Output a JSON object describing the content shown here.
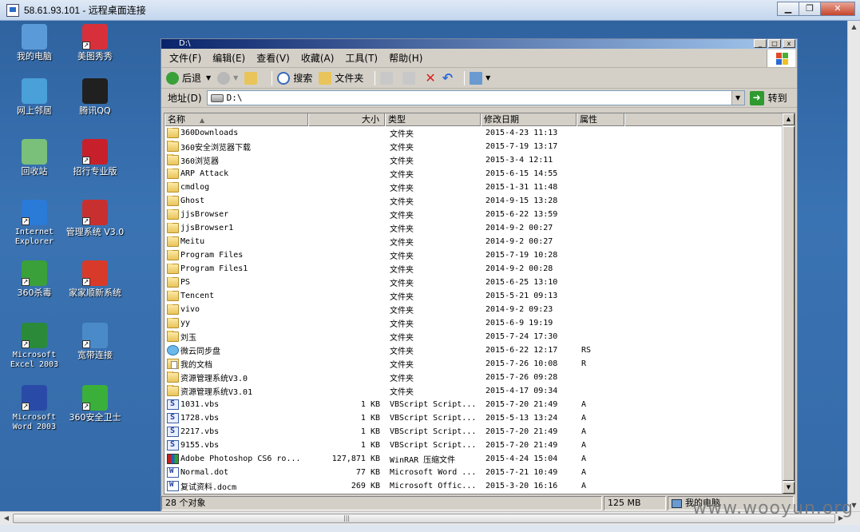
{
  "rdp": {
    "title": "58.61.93.101 - 远程桌面连接",
    "min": "▁",
    "restore": "❐",
    "close": "✕"
  },
  "watermark": "www.wooyun.org",
  "desktop_icons": [
    {
      "id": "my-computer",
      "label": "我的电脑",
      "color": "#5a9ad8"
    },
    {
      "id": "meitu",
      "label": "美图秀秀",
      "color": "#d8303a"
    },
    {
      "id": "network",
      "label": "网上邻居",
      "color": "#4aa0d8"
    },
    {
      "id": "qq",
      "label": "腾讯QQ",
      "color": "#202020"
    },
    {
      "id": "recycle",
      "label": "回收站",
      "color": "#7ac07a"
    },
    {
      "id": "zhaohang",
      "label": "招行专业版",
      "color": "#c8202a"
    },
    {
      "id": "ie",
      "label": "Internet Explorer",
      "color": "#2a7ad8"
    },
    {
      "id": "mgmt",
      "label": "管理系统 V3.0",
      "color": "#c83030"
    },
    {
      "id": "av360",
      "label": "360杀毒",
      "color": "#3aa03a"
    },
    {
      "id": "jjs",
      "label": "家家顺新系统",
      "color": "#d83a2a"
    },
    {
      "id": "excel",
      "label": "Microsoft Excel 2003",
      "color": "#2a8a3a"
    },
    {
      "id": "broadband",
      "label": "宽带连接",
      "color": "#4a8ac8"
    },
    {
      "id": "word",
      "label": "Microsoft Word 2003",
      "color": "#2a4aa8"
    },
    {
      "id": "safe360",
      "label": "360安全卫士",
      "color": "#3ab03a"
    }
  ],
  "explorer": {
    "title": "D:\\",
    "menu": [
      "文件(F)",
      "编辑(E)",
      "查看(V)",
      "收藏(A)",
      "工具(T)",
      "帮助(H)"
    ],
    "toolbar": {
      "back": "后退",
      "search": "搜索",
      "folders": "文件夹"
    },
    "address": {
      "label": "地址(D)",
      "value": "D:\\",
      "go": "转到"
    },
    "columns": {
      "name": "名称",
      "size": "大小",
      "type": "类型",
      "date": "修改日期",
      "attr": "属性"
    },
    "files": [
      {
        "name": "360Downloads",
        "size": "",
        "type": "文件夹",
        "date": "2015-4-23 11:13",
        "attr": "",
        "icon": "folder"
      },
      {
        "name": "360安全浏览器下载",
        "size": "",
        "type": "文件夹",
        "date": "2015-7-19 13:17",
        "attr": "",
        "icon": "folder"
      },
      {
        "name": "360浏览器",
        "size": "",
        "type": "文件夹",
        "date": "2015-3-4 12:11",
        "attr": "",
        "icon": "folder"
      },
      {
        "name": "ARP Attack",
        "size": "",
        "type": "文件夹",
        "date": "2015-6-15 14:55",
        "attr": "",
        "icon": "folder"
      },
      {
        "name": "cmdlog",
        "size": "",
        "type": "文件夹",
        "date": "2015-1-31 11:48",
        "attr": "",
        "icon": "folder"
      },
      {
        "name": "Ghost",
        "size": "",
        "type": "文件夹",
        "date": "2014-9-15 13:28",
        "attr": "",
        "icon": "folder"
      },
      {
        "name": "jjsBrowser",
        "size": "",
        "type": "文件夹",
        "date": "2015-6-22 13:59",
        "attr": "",
        "icon": "folder"
      },
      {
        "name": "jjsBrowser1",
        "size": "",
        "type": "文件夹",
        "date": "2014-9-2 00:27",
        "attr": "",
        "icon": "folder"
      },
      {
        "name": "Meitu",
        "size": "",
        "type": "文件夹",
        "date": "2014-9-2 00:27",
        "attr": "",
        "icon": "folder"
      },
      {
        "name": "Program Files",
        "size": "",
        "type": "文件夹",
        "date": "2015-7-19 10:28",
        "attr": "",
        "icon": "folder"
      },
      {
        "name": "Program Files1",
        "size": "",
        "type": "文件夹",
        "date": "2014-9-2 00:28",
        "attr": "",
        "icon": "folder"
      },
      {
        "name": "PS",
        "size": "",
        "type": "文件夹",
        "date": "2015-6-25 13:10",
        "attr": "",
        "icon": "folder"
      },
      {
        "name": "Tencent",
        "size": "",
        "type": "文件夹",
        "date": "2015-5-21 09:13",
        "attr": "",
        "icon": "folder"
      },
      {
        "name": "vivo",
        "size": "",
        "type": "文件夹",
        "date": "2014-9-2 09:23",
        "attr": "",
        "icon": "folder"
      },
      {
        "name": "yy",
        "size": "",
        "type": "文件夹",
        "date": "2015-6-9 19:19",
        "attr": "",
        "icon": "folder"
      },
      {
        "name": "刘玉",
        "size": "",
        "type": "文件夹",
        "date": "2015-7-24 17:30",
        "attr": "",
        "icon": "folder"
      },
      {
        "name": "微云同步盘",
        "size": "",
        "type": "文件夹",
        "date": "2015-6-22 12:17",
        "attr": "RS",
        "icon": "cloud"
      },
      {
        "name": "我的文档",
        "size": "",
        "type": "文件夹",
        "date": "2015-7-26 10:08",
        "attr": "R",
        "icon": "docs"
      },
      {
        "name": "资源管理系统V3.0",
        "size": "",
        "type": "文件夹",
        "date": "2015-7-26 09:28",
        "attr": "",
        "icon": "folder"
      },
      {
        "name": "资源管理系统V3.01",
        "size": "",
        "type": "文件夹",
        "date": "2015-4-17 09:34",
        "attr": "",
        "icon": "folder"
      },
      {
        "name": "1031.vbs",
        "size": "1 KB",
        "type": "VBScript Script...",
        "date": "2015-7-20 21:49",
        "attr": "A",
        "icon": "vbs"
      },
      {
        "name": "1728.vbs",
        "size": "1 KB",
        "type": "VBScript Script...",
        "date": "2015-5-13 13:24",
        "attr": "A",
        "icon": "vbs"
      },
      {
        "name": "2217.vbs",
        "size": "1 KB",
        "type": "VBScript Script...",
        "date": "2015-7-20 21:49",
        "attr": "A",
        "icon": "vbs"
      },
      {
        "name": "9155.vbs",
        "size": "1 KB",
        "type": "VBScript Script...",
        "date": "2015-7-20 21:49",
        "attr": "A",
        "icon": "vbs"
      },
      {
        "name": "Adobe Photoshop CS6  ro...",
        "size": "127,871 KB",
        "type": "WinRAR 压缩文件",
        "date": "2015-4-24 15:04",
        "attr": "A",
        "icon": "rar"
      },
      {
        "name": "Normal.dot",
        "size": "77 KB",
        "type": "Microsoft Word ...",
        "date": "2015-7-21 10:49",
        "attr": "A",
        "icon": "word"
      },
      {
        "name": "复试资料.docm",
        "size": "269 KB",
        "type": "Microsoft Offic...",
        "date": "2015-3-20 16:16",
        "attr": "A",
        "icon": "word"
      }
    ],
    "status": {
      "count": "28 个对象",
      "size": "125 MB",
      "location": "我的电脑"
    }
  }
}
